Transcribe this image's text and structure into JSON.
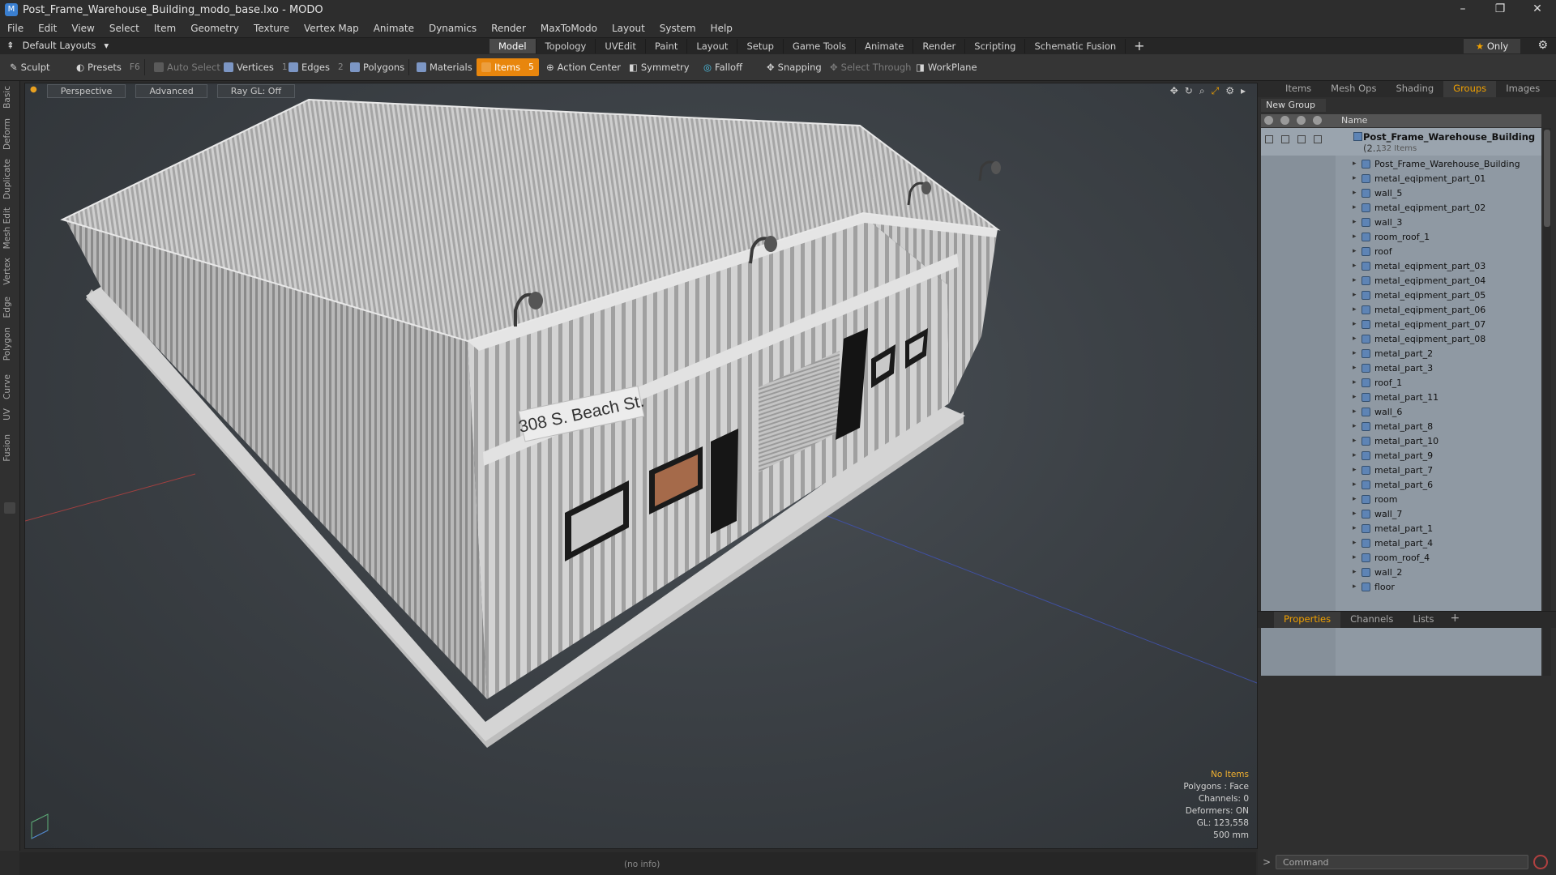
{
  "window": {
    "title": "Post_Frame_Warehouse_Building_modo_base.lxo - MODO",
    "controls": [
      "–",
      "❐",
      "✕"
    ]
  },
  "menu": [
    "File",
    "Edit",
    "View",
    "Select",
    "Item",
    "Geometry",
    "Texture",
    "Vertex Map",
    "Animate",
    "Dynamics",
    "Render",
    "MaxToModo",
    "Layout",
    "System",
    "Help"
  ],
  "layout": {
    "selector": "Default Layouts",
    "tabs": [
      "Model",
      "Topology",
      "UVEdit",
      "Paint",
      "Layout",
      "Setup",
      "Game Tools",
      "Animate",
      "Render",
      "Scripting",
      "Schematic Fusion"
    ],
    "active_tab": "Model",
    "only_label": "Only"
  },
  "toolbar": {
    "sculpt": "Sculpt",
    "presets": "Presets",
    "presets_key": "F6",
    "auto_select": "Auto Select",
    "vertices": "Vertices",
    "vertices_key": "1",
    "edges": "Edges",
    "edges_key": "2",
    "polygons": "Polygons",
    "materials": "Materials",
    "items": "Items",
    "items_key": "5",
    "action_center": "Action Center",
    "symmetry": "Symmetry",
    "falloff": "Falloff",
    "snapping": "Snapping",
    "select_through": "Select Through",
    "workplane": "WorkPlane"
  },
  "left_tabs": [
    "Basic",
    "Deform",
    "Duplicate",
    "Mesh Edit",
    "Vertex",
    "Edge",
    "Polygon",
    "Curve",
    "UV",
    "Fusion"
  ],
  "viewport": {
    "view": "Perspective",
    "shading": "Advanced",
    "raygl": "Ray GL: Off",
    "sign_text": "308 S. Beach St.",
    "info": {
      "no_items": "No Items",
      "polygons": "Polygons : Face",
      "channels": "Channels: 0",
      "deformers": "Deformers: ON",
      "gl": "GL: 123,558",
      "scale": "500 mm"
    }
  },
  "status": {
    "info": "(no info)"
  },
  "right_panel": {
    "tabs": [
      "Items",
      "Mesh Ops",
      "Shading",
      "Groups",
      "Images"
    ],
    "active_tab": "Groups",
    "new_group": "New Group",
    "col_name": "Name",
    "group": {
      "name": "Post_Frame_Warehouse_Building",
      "suffix": "(2...",
      "count": "132 Items"
    },
    "items": [
      "Post_Frame_Warehouse_Building",
      "metal_eqipment_part_01",
      "wall_5",
      "metal_eqipment_part_02",
      "wall_3",
      "room_roof_1",
      "roof",
      "metal_eqipment_part_03",
      "metal_eqipment_part_04",
      "metal_eqipment_part_05",
      "metal_eqipment_part_06",
      "metal_eqipment_part_07",
      "metal_eqipment_part_08",
      "metal_part_2",
      "metal_part_3",
      "roof_1",
      "metal_part_11",
      "wall_6",
      "metal_part_8",
      "metal_part_10",
      "metal_part_9",
      "metal_part_7",
      "metal_part_6",
      "room",
      "wall_7",
      "metal_part_1",
      "metal_part_4",
      "room_roof_4",
      "wall_2",
      "floor"
    ],
    "props_tabs": [
      "Properties",
      "Channels",
      "Lists"
    ],
    "props_active": "Properties"
  },
  "command": {
    "placeholder": "Command",
    "prompt": ">"
  },
  "colors": {
    "accent": "#e8860d",
    "tab_active": "#f0a000",
    "list_bg": "#8f99a3"
  }
}
